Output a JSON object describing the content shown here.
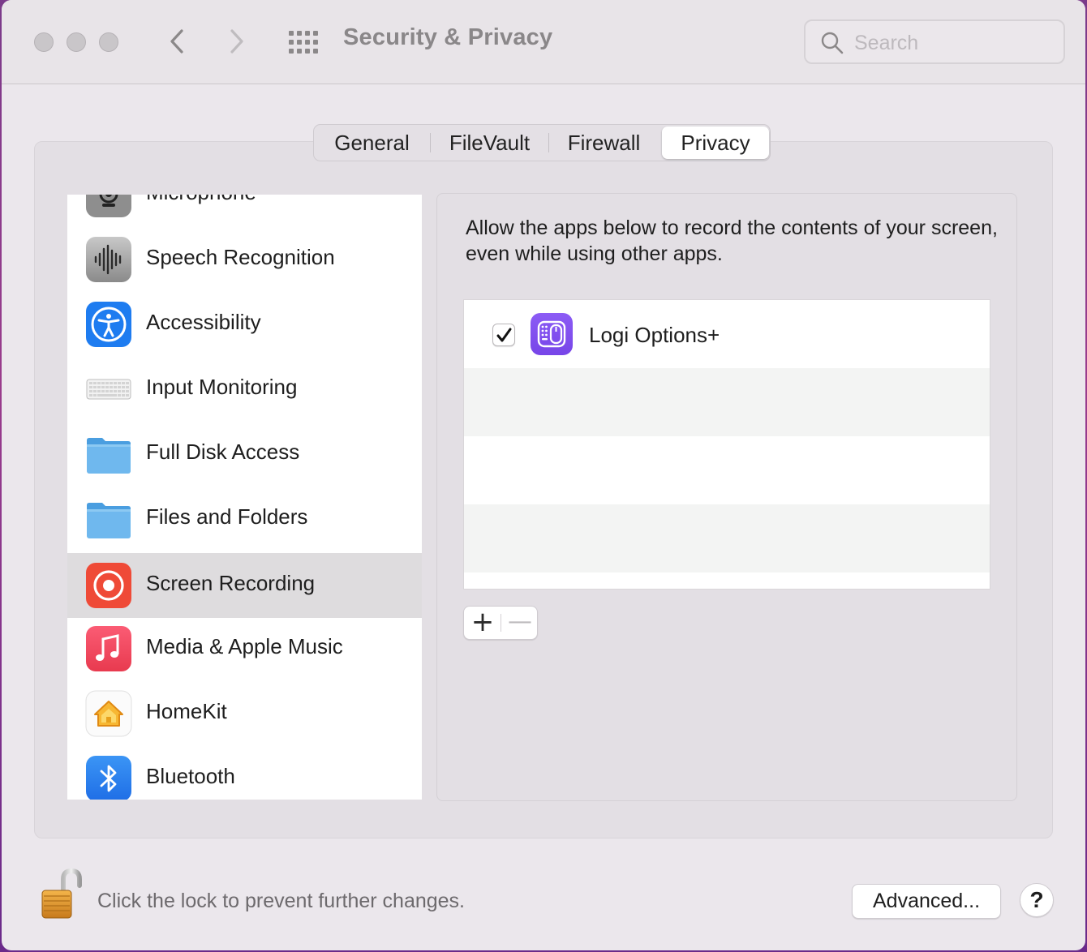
{
  "window": {
    "title": "Security & Privacy",
    "search_placeholder": "Search"
  },
  "tabs": [
    {
      "label": "General",
      "active": false
    },
    {
      "label": "FileVault",
      "active": false
    },
    {
      "label": "Firewall",
      "active": false
    },
    {
      "label": "Privacy",
      "active": true
    }
  ],
  "sidebar": {
    "items": [
      {
        "label": "Microphone",
        "icon": "microphone-icon"
      },
      {
        "label": "Speech Recognition",
        "icon": "speech-recognition-icon"
      },
      {
        "label": "Accessibility",
        "icon": "accessibility-icon"
      },
      {
        "label": "Input Monitoring",
        "icon": "keyboard-icon"
      },
      {
        "label": "Full Disk Access",
        "icon": "folder-icon"
      },
      {
        "label": "Files and Folders",
        "icon": "folder-icon"
      },
      {
        "label": "Screen Recording",
        "icon": "screen-recording-icon",
        "selected": true
      },
      {
        "label": "Media & Apple Music",
        "icon": "music-icon"
      },
      {
        "label": "HomeKit",
        "icon": "home-icon"
      },
      {
        "label": "Bluetooth",
        "icon": "bluetooth-icon"
      }
    ]
  },
  "panel": {
    "description": "Allow the apps below to record the contents of your screen, even while using other apps.",
    "apps": [
      {
        "name": "Logi Options+",
        "checked": true,
        "icon": "logi-options-icon"
      }
    ],
    "add_label": "+",
    "remove_label": "—"
  },
  "footer": {
    "lock_text": "Click the lock to prevent further changes.",
    "advanced_label": "Advanced...",
    "help_label": "?"
  },
  "colors": {
    "accent_purple": "#7f4ff0",
    "recording_red": "#ef4a37",
    "accessibility_blue": "#1e7cf0",
    "folder_blue": "#6fb8ee"
  }
}
